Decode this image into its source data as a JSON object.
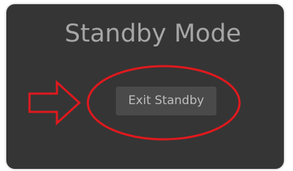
{
  "window": {
    "title": "Standby Mode"
  },
  "actions": {
    "exit_label": "Exit Standby"
  },
  "annotation": {
    "color": "#e0191d",
    "shapes": [
      "arrow-right",
      "ellipse-highlight"
    ]
  },
  "colors": {
    "panel_background": "#353535",
    "title_text": "#a6a6a6",
    "button_background": "#4a4a4a",
    "button_text": "#bdbdbd"
  }
}
